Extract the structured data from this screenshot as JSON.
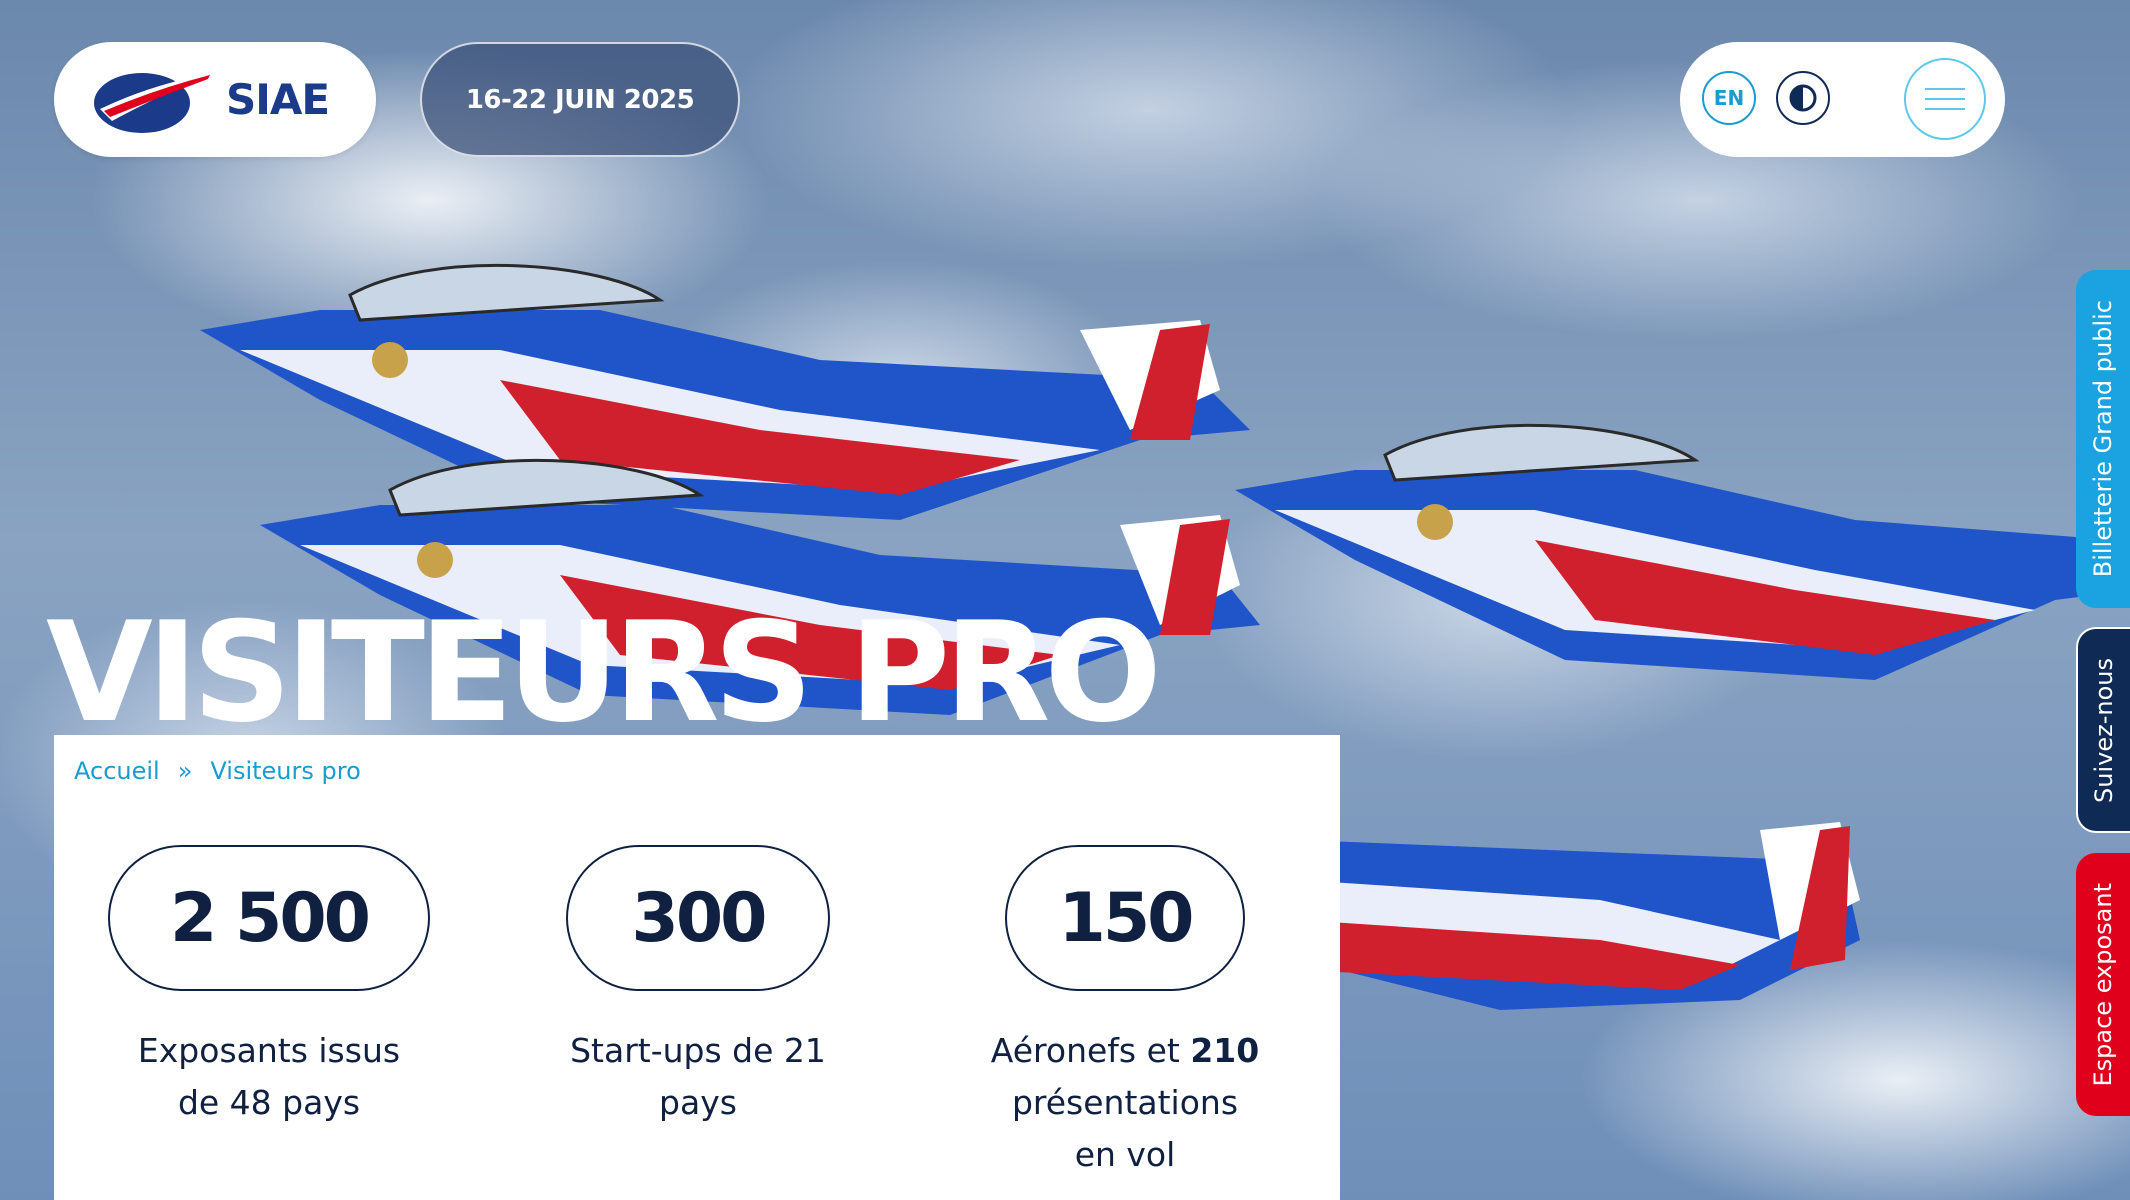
{
  "header": {
    "logo_text": "SIAE",
    "date_label": "16-22 JUIN 2025",
    "lang_label": "EN",
    "contrast_icon": "contrast-icon",
    "menu_icon": "hamburger-menu-icon"
  },
  "hero": {
    "title": "VISITEURS PRO"
  },
  "breadcrumb": {
    "items": [
      "Accueil",
      "Visiteurs pro"
    ],
    "separator": "»"
  },
  "stats": [
    {
      "value": "2 500",
      "desc_line1": "Exposants issus",
      "desc_line2": "de 48 pays"
    },
    {
      "value": "300",
      "desc_line1": "Start-ups de 21",
      "desc_line2": "pays"
    },
    {
      "value": "150",
      "desc_pre": "Aéronefs et ",
      "desc_bold": "210",
      "desc_line2": "présentations",
      "desc_line3": "en vol"
    }
  ],
  "side_tabs": {
    "billetterie": "Billetterie Grand public",
    "suivez": "Suivez-nous",
    "espace": "Espace exposant"
  },
  "colors": {
    "accent_blue": "#1a9cd0",
    "navy": "#0f2040",
    "brand_blue": "#1b3a8a",
    "tab_light_blue": "#1aa3e0",
    "tab_red": "#e0001c"
  }
}
